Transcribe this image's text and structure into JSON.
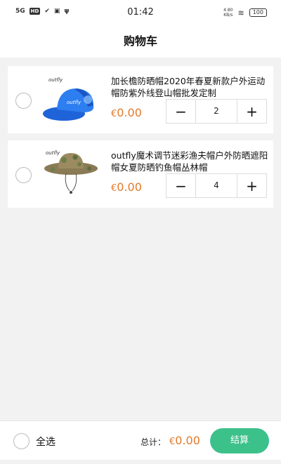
{
  "status_bar": {
    "signal": "5G",
    "hd": "HD",
    "time": "01:42",
    "net_speed": "4.80",
    "net_unit": "KB/s",
    "battery": "100"
  },
  "nav": {
    "title": "购物车"
  },
  "items": [
    {
      "title": "加长檐防晒帽2020年春夏新款户外运动帽防紫外线登山帽批发定制",
      "currency": "€",
      "price": "0.00",
      "quantity": "2",
      "image_brand": "outfly",
      "image_kind": "blue-cap"
    },
    {
      "title": "outfly魔术调节迷彩渔夫帽户外防晒遮阳帽女夏防晒钓鱼帽丛林帽",
      "currency": "€",
      "price": "0.00",
      "quantity": "4",
      "image_brand": "outfly",
      "image_kind": "camo-bucket-hat"
    }
  ],
  "stepper": {
    "minus": "−",
    "plus": "+"
  },
  "footer": {
    "select_all": "全选",
    "total_label": "总计：",
    "currency": "€",
    "total": "0.00",
    "checkout": "结算"
  },
  "colors": {
    "price": "#e27a2a",
    "checkout": "#3cc18a",
    "background": "#f2f2f2"
  }
}
